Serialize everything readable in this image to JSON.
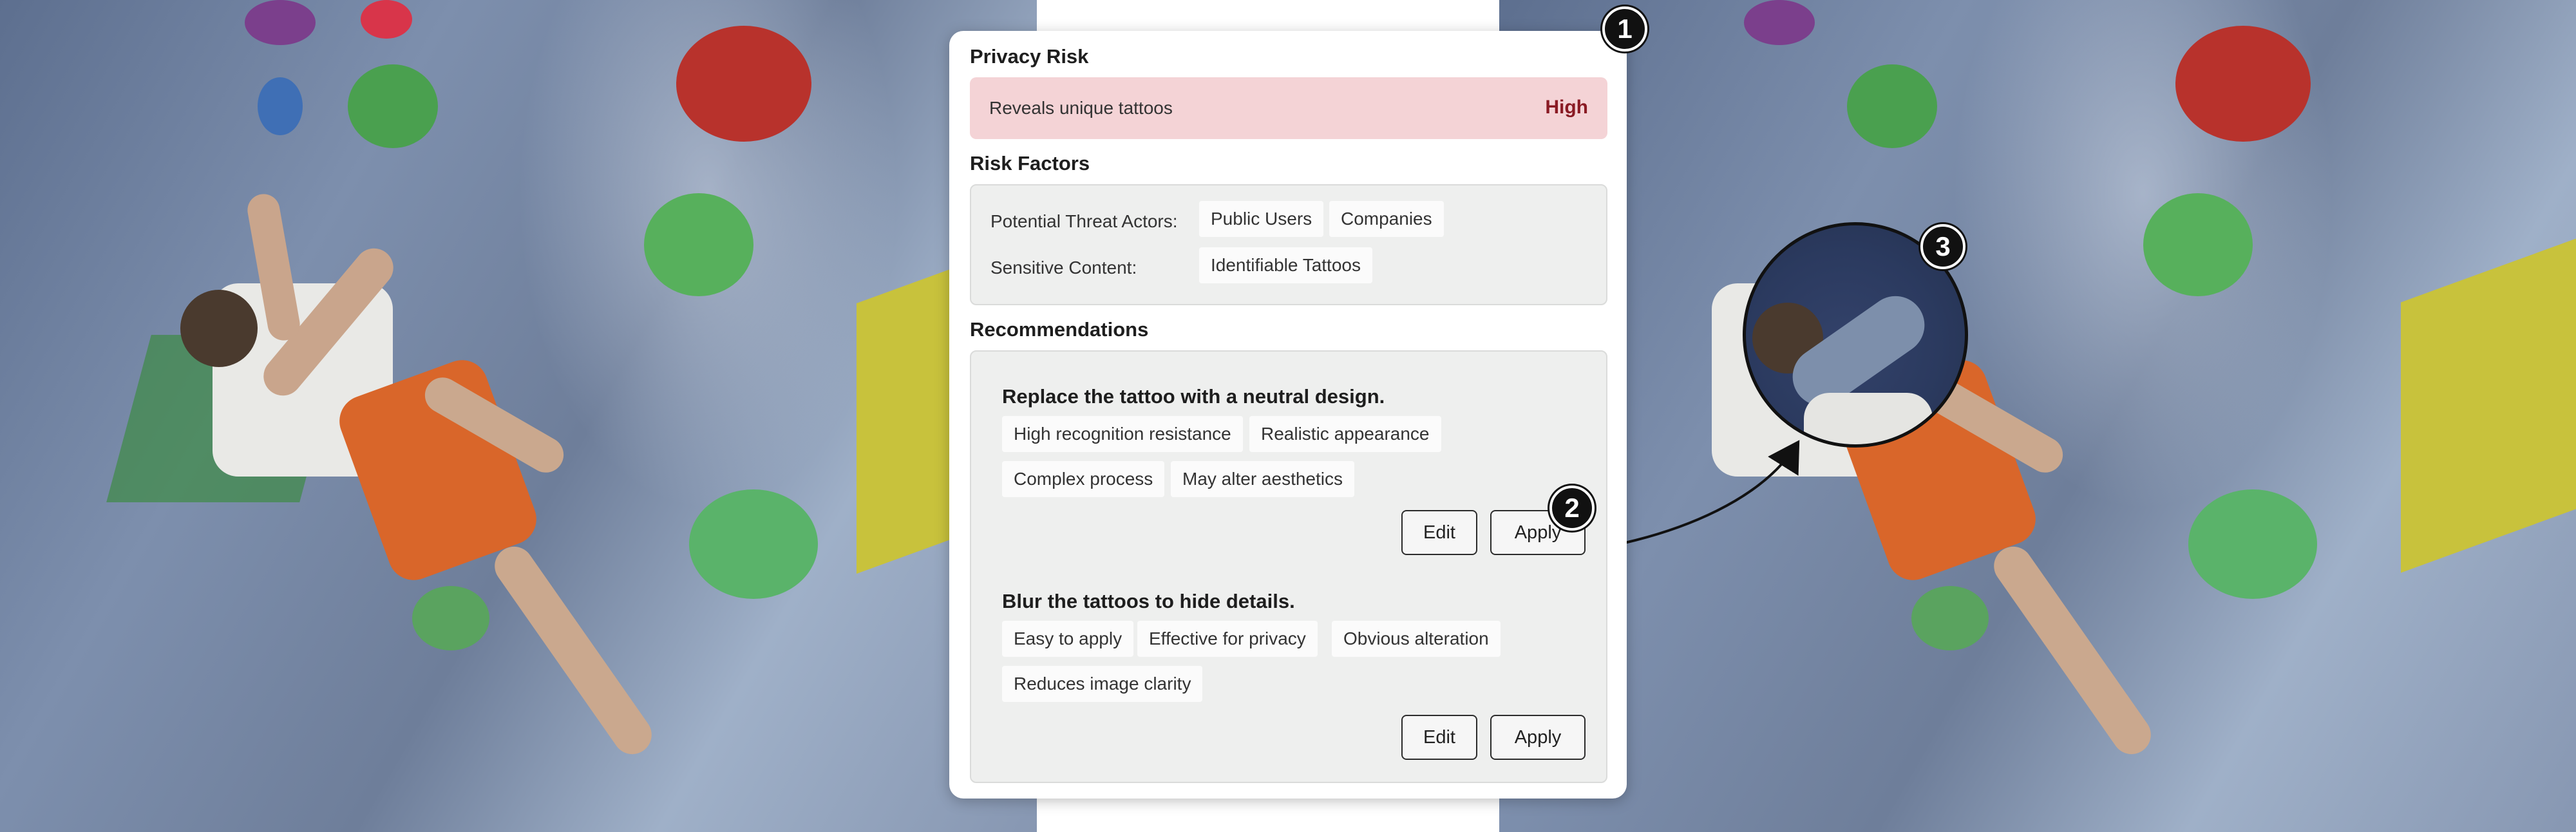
{
  "privacy_risk": {
    "title": "Privacy Risk",
    "description": "Reveals unique tattoos",
    "level": "High"
  },
  "risk_factors": {
    "title": "Risk Factors",
    "threat_actors_label": "Potential Threat Actors:",
    "threat_actors": [
      "Public Users",
      "Companies"
    ],
    "sensitive_content_label": "Sensitive Content:",
    "sensitive_content": [
      "Identifiable Tattoos"
    ]
  },
  "recommendations": {
    "title": "Recommendations",
    "items": [
      {
        "title": "Replace the tattoo with a neutral design.",
        "tags": [
          "High recognition resistance",
          "Realistic appearance",
          "Complex process",
          "May alter aesthetics"
        ],
        "edit_label": "Edit",
        "apply_label": "Apply"
      },
      {
        "title": "Blur the tattoos to hide details.",
        "tags": [
          "Easy to apply",
          "Effective for privacy",
          "Obvious alteration",
          "Reduces image clarity"
        ],
        "edit_label": "Edit",
        "apply_label": "Apply"
      }
    ]
  },
  "callouts": [
    "1",
    "2",
    "3"
  ],
  "colors": {
    "risk_background": "#f4d3d6",
    "risk_level": "#8a1a24",
    "panel_background": "#eeefee"
  }
}
